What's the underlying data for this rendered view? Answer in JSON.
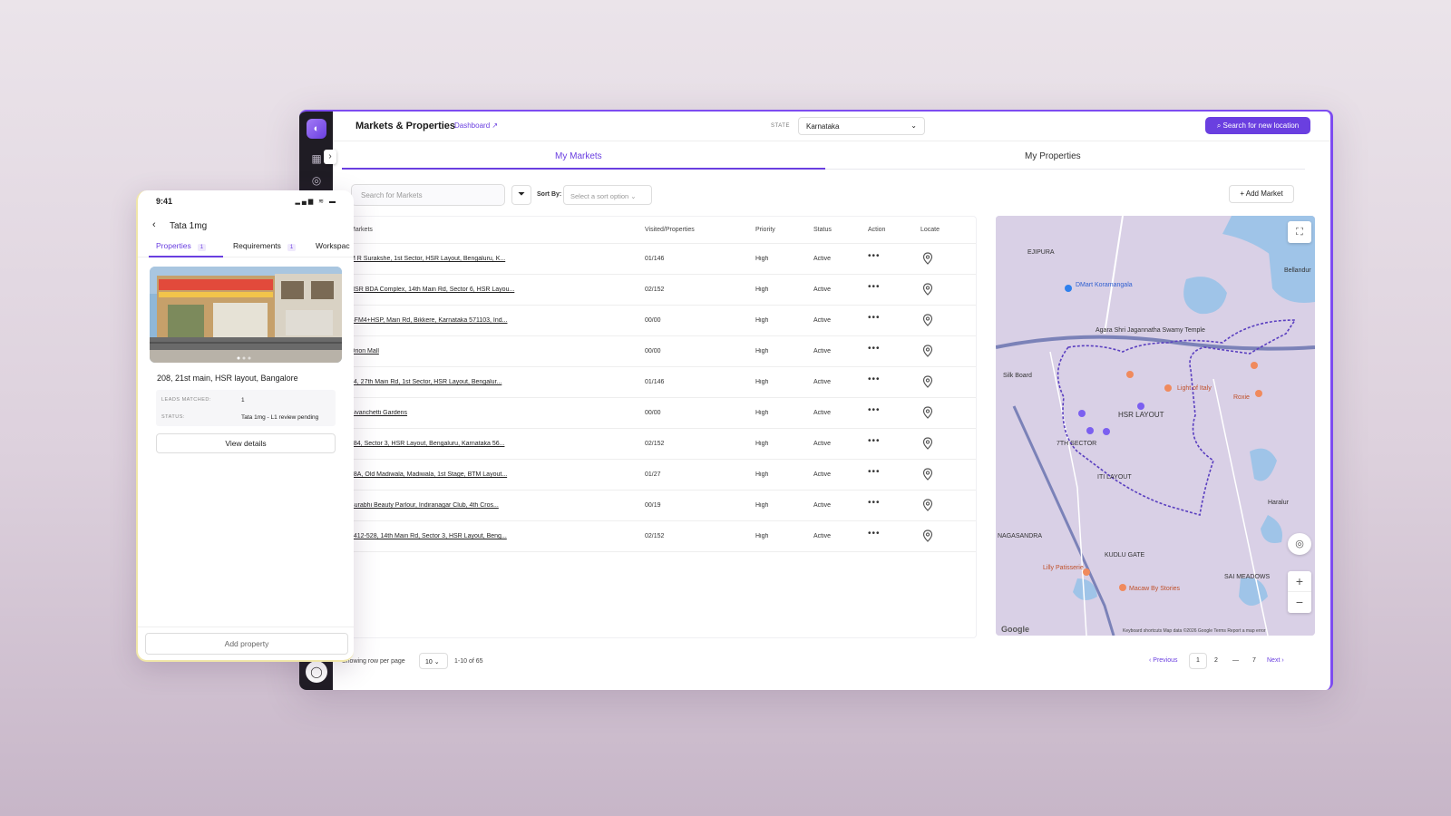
{
  "desktop": {
    "title": "Markets & Properties",
    "dashboard_link": "Dashboard",
    "state_label": "STATE",
    "state_value": "Karnataka",
    "search_location_button": "Search for new location",
    "tabs": [
      {
        "label": "My Markets"
      },
      {
        "label": "My Properties"
      }
    ],
    "search_placeholder": "Search for Markets",
    "sort_label": "Sort By:",
    "sort_placeholder": "Select a sort option",
    "add_market": "+ Add Market",
    "columns": {
      "markets": "Markets",
      "visited": "Visited/Properties",
      "priority": "Priority",
      "status": "Status",
      "action": "Action",
      "locate": "Locate"
    },
    "rows": [
      {
        "market": "M R Surakshe, 1st Sector, HSR Layout, Bengaluru, K...",
        "visited": "01/146",
        "priority": "High",
        "status": "Active"
      },
      {
        "market": "HSR BDA Complex, 14th Main Rd, Sector 6, HSR Layou...",
        "visited": "02/152",
        "priority": "High",
        "status": "Active"
      },
      {
        "market": "BFM4+HSP, Main Rd, Bikkere, Karnataka 571103, Ind...",
        "visited": "00/00",
        "priority": "High",
        "status": "Active"
      },
      {
        "market": "Orion Mall",
        "visited": "00/00",
        "priority": "High",
        "status": "Active"
      },
      {
        "market": "64, 27th Main Rd, 1st Sector, HSR Layout, Bengalur...",
        "visited": "01/146",
        "priority": "High",
        "status": "Active"
      },
      {
        "market": "Sivanchetti Gardens",
        "visited": "00/00",
        "priority": "High",
        "status": "Active"
      },
      {
        "market": "684, Sector 3, HSR Layout, Bengaluru, Karnataka 56...",
        "visited": "02/152",
        "priority": "High",
        "status": "Active"
      },
      {
        "market": "48A, Old Madiwala, Madiwala, 1st Stage, BTM Layout...",
        "visited": "01/27",
        "priority": "High",
        "status": "Active"
      },
      {
        "market": "Surabhi Beauty Parlour, Indiranagar Club, 4th Cros...",
        "visited": "00/19",
        "priority": "High",
        "status": "Active"
      },
      {
        "market": "1412-528, 14th Main Rd, Sector 3, HSR Layout, Beng...",
        "visited": "02/152",
        "priority": "High",
        "status": "Active"
      }
    ],
    "action_dots": "•••",
    "footer": {
      "rows_per_page_label": "Showing row per page",
      "rows_per_page": "10",
      "range": "1-10 of 65",
      "previous": "‹ Previous",
      "pages": [
        "1",
        "2",
        "—",
        "7"
      ],
      "next": "Next ›"
    },
    "map": {
      "labels": [
        "EJIPURA",
        "DMart Koramangala",
        "Agara Shri Jagannatha Swamy Temple",
        "HSR LAYOUT",
        "7TH SECTOR",
        "ITI LAYOUT",
        "Haralur",
        "KUDLU GATE",
        "Macaw By Stories",
        "Silk Board",
        "Bellandur",
        "SAI MEADOWS",
        "NAGASANDRA",
        "Lilly Patisserie",
        "Roxie",
        "Light of Italy"
      ],
      "footer": "Keyboard shortcuts   Map data ©2026 Google   Terms   Report a map error",
      "google": "Google",
      "zoom_in": "+",
      "zoom_out": "−"
    }
  },
  "phone": {
    "time": "9:41",
    "status_icons": "▂▄▆ ≋ ▬",
    "title": "Tata 1mg",
    "tabs": [
      {
        "label": "Properties",
        "count": "1"
      },
      {
        "label": "Requirements",
        "count": "1"
      },
      {
        "label": "Workspac"
      }
    ],
    "address": "208, 21st main, HSR layout, Bangalore",
    "leads_label": "LEADS MATCHED:",
    "leads_value": "1",
    "status_label": "STATUS:",
    "status_value": "Tata 1mg - L1 review pending",
    "view_details": "View details",
    "add_property": "Add property"
  }
}
